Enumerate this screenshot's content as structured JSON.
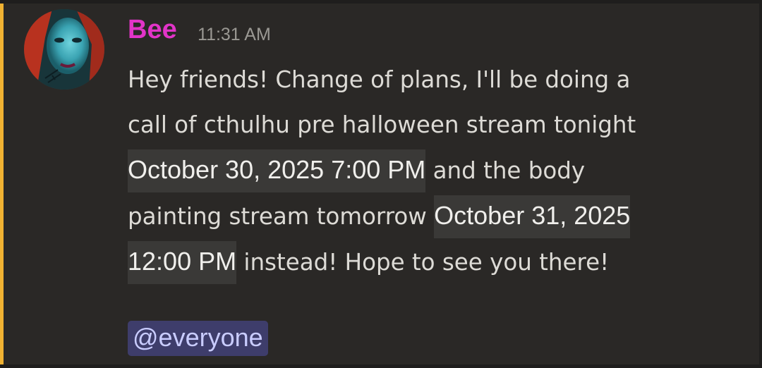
{
  "message": {
    "author": "Bee",
    "time": "11:31 AM",
    "line1": "Hey friends! Change of plans, I'll be doing a",
    "line2": "call of cthulhu pre halloween stream tonight",
    "timestamp1": "October 30, 2025 7:00 PM",
    "mid_text": " and the body",
    "line4_start": "painting stream tomorrow ",
    "timestamp2_part1": "October 31, 2025",
    "timestamp2_part2": "12:00 PM",
    "end_text": "  instead! Hope to see you there!",
    "mention": "@everyone"
  },
  "colors": {
    "author": "#e234c8",
    "mention_bar": "#f0b232",
    "background": "#2a2826",
    "timestamp_chip": "#3a3937",
    "mention_bg": "#3e3d6b",
    "mention_text": "#c9ccff"
  },
  "icons": {
    "avatar": "user-avatar"
  }
}
